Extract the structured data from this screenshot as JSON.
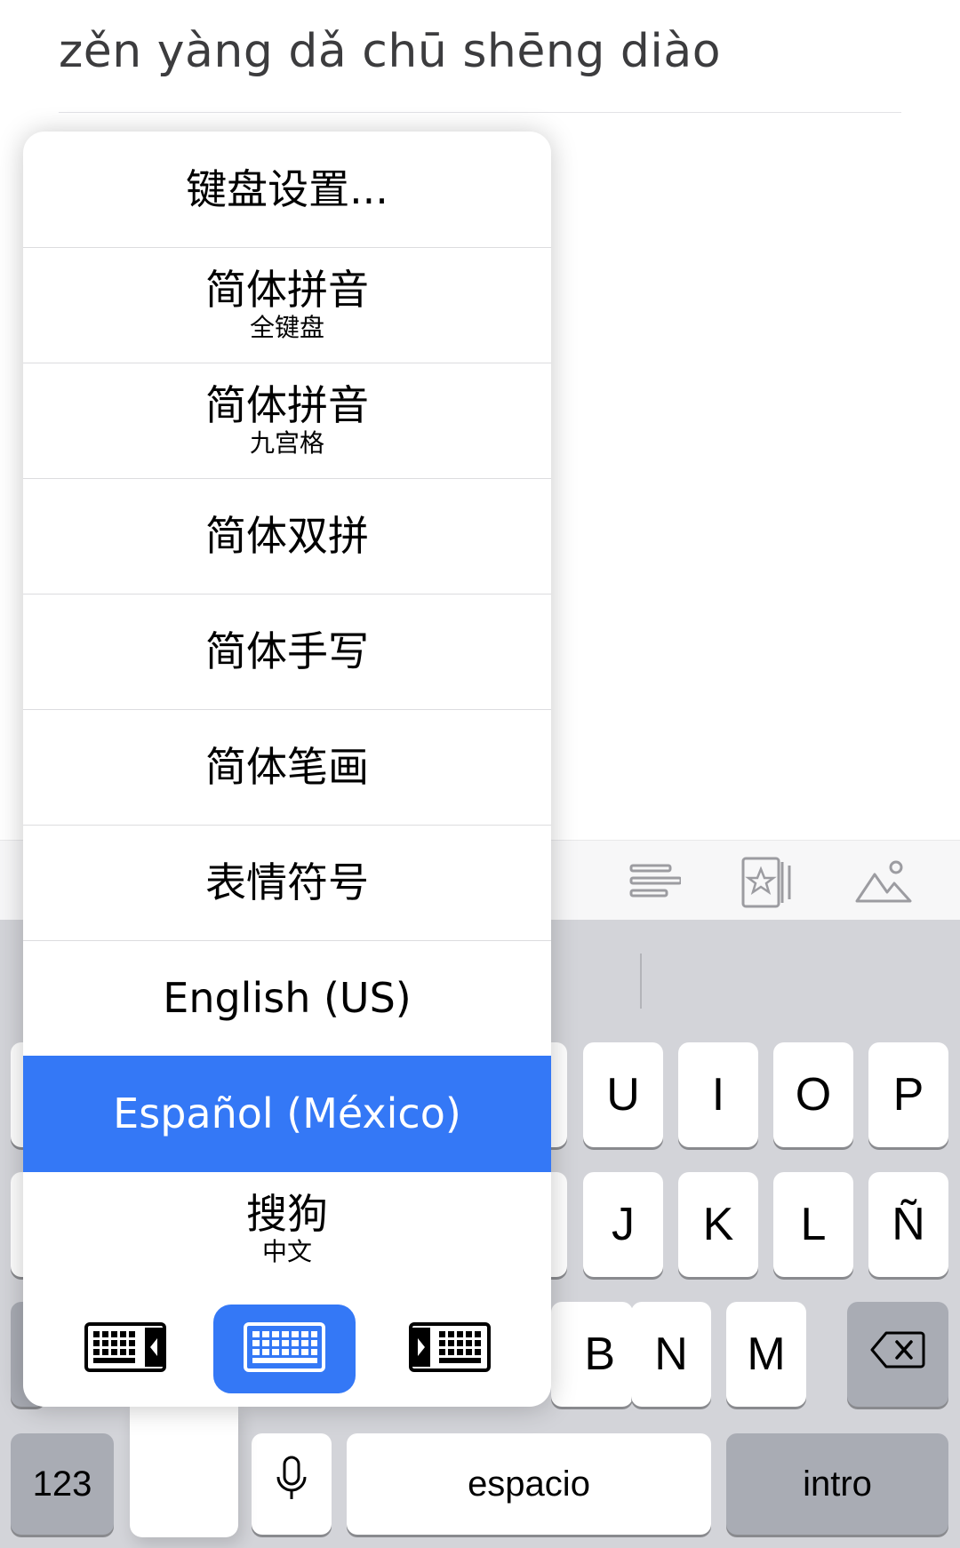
{
  "note": {
    "text": "zěn yàng dǎ chū shēng diào"
  },
  "toolbar": {
    "icons": [
      "align-text-icon",
      "starred-cards-icon",
      "image-icon"
    ]
  },
  "keyboard_menu": {
    "items": [
      {
        "label": "键盘设置...",
        "sub": ""
      },
      {
        "label": "简体拼音",
        "sub": "全键盘"
      },
      {
        "label": "简体拼音",
        "sub": "九宫格"
      },
      {
        "label": "简体双拼",
        "sub": ""
      },
      {
        "label": "简体手写",
        "sub": ""
      },
      {
        "label": "简体笔画",
        "sub": ""
      },
      {
        "label": "表情符号",
        "sub": ""
      },
      {
        "label": "English (US)",
        "sub": ""
      },
      {
        "label": "Español (México)",
        "sub": "",
        "selected": true
      },
      {
        "label": "搜狗",
        "sub": "中文"
      }
    ],
    "modes": [
      "keyboard-left-icon",
      "keyboard-full-icon",
      "keyboard-right-icon"
    ],
    "selected_mode": "keyboard-full-icon"
  },
  "keyboard": {
    "row1": [
      "U",
      "I",
      "O",
      "P"
    ],
    "row2": [
      "J",
      "K",
      "L",
      "Ñ"
    ],
    "row3": [
      "B",
      "N",
      "M"
    ],
    "numbers_label": "123",
    "space_label": "espacio",
    "return_label": "intro"
  },
  "colors": {
    "accent": "#3478f6",
    "keyboard_bg": "#d3d4d9",
    "dark_key": "#a9acb4"
  }
}
